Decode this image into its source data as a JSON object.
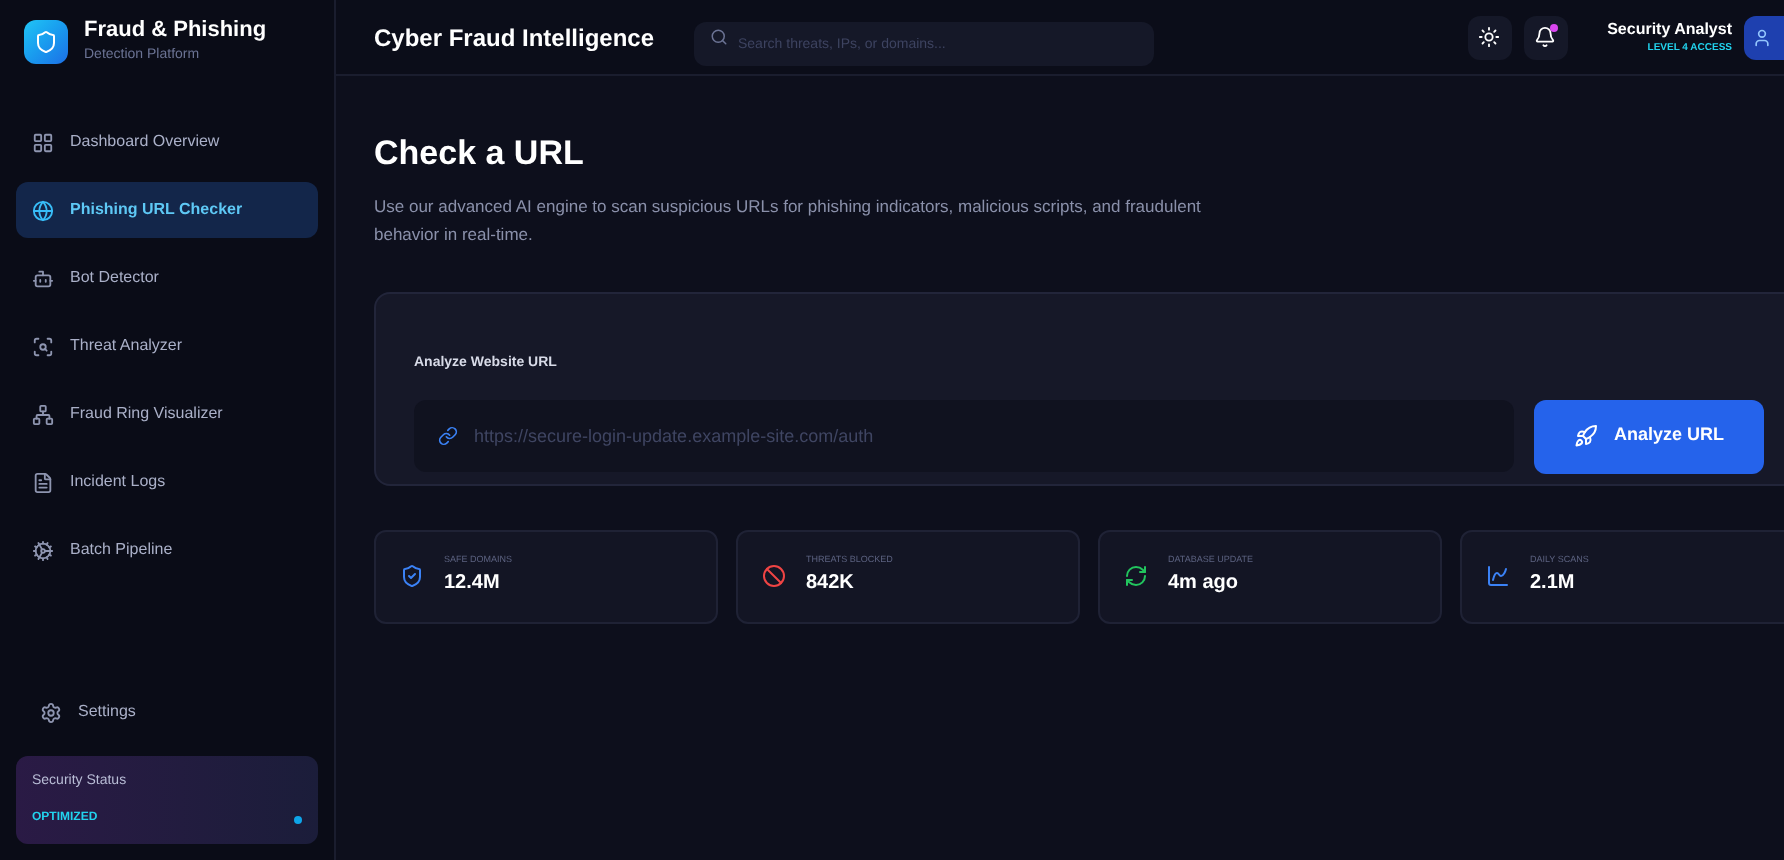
{
  "brand": {
    "title": "Fraud & Phishing",
    "subtitle": "Detection Platform"
  },
  "nav": [
    {
      "label": "Dashboard Overview",
      "selected": false
    },
    {
      "label": "Phishing URL Checker",
      "selected": true
    },
    {
      "label": "Bot Detector",
      "selected": false
    },
    {
      "label": "Threat Analyzer",
      "selected": false
    },
    {
      "label": "Fraud Ring Visualizer",
      "selected": false
    },
    {
      "label": "Incident Logs",
      "selected": false
    },
    {
      "label": "Batch Pipeline",
      "selected": false
    }
  ],
  "settings": {
    "label": "Settings"
  },
  "security_status": {
    "label": "Security Status",
    "value": "OPTIMIZED"
  },
  "header": {
    "title": "Cyber Fraud Intelligence",
    "search_placeholder": "Search threats, IPs, or domains...",
    "notification": true,
    "user": {
      "name": "Security Analyst",
      "role": "LEVEL 4 ACCESS"
    }
  },
  "page": {
    "title": "Check a URL",
    "description": "Use our advanced AI engine to scan suspicious URLs for phishing indicators, malicious scripts, and fraudulent behavior in real-time."
  },
  "analyzer": {
    "label": "Analyze Website URL",
    "placeholder": "https://secure-login-update.example-site.com/auth",
    "button": "Analyze URL"
  },
  "stats": [
    {
      "label": "SAFE DOMAINS",
      "value": "12.4M",
      "color": "#3b82f6"
    },
    {
      "label": "THREATS BLOCKED",
      "value": "842K",
      "color": "#ef4444"
    },
    {
      "label": "DATABASE UPDATE",
      "value": "4m ago",
      "color": "#22c55e"
    },
    {
      "label": "DAILY SCANS",
      "value": "2.1M",
      "color": "#3b82f6"
    }
  ]
}
